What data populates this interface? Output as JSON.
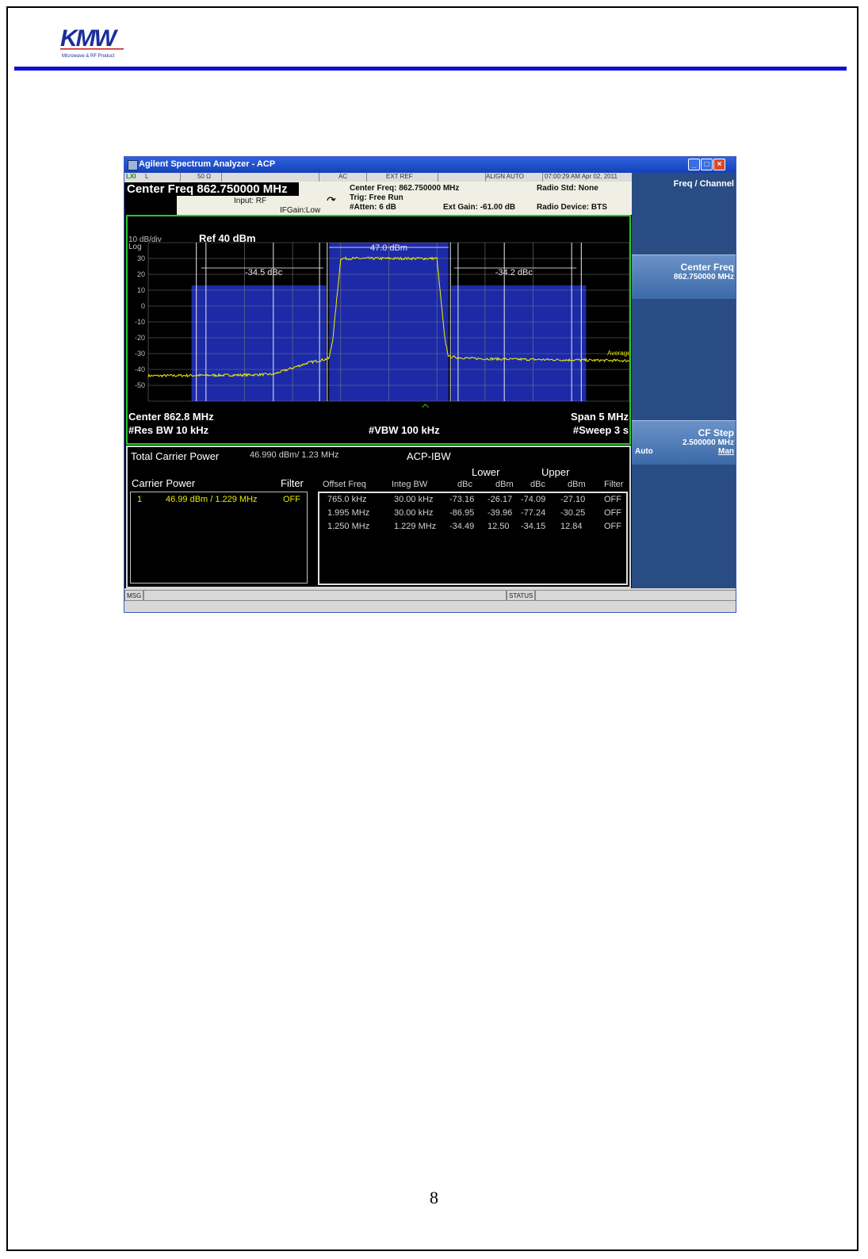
{
  "document": {
    "page_number": "8"
  },
  "logo": {
    "name": "KMW",
    "tagline": "Microwave & RF Product"
  },
  "window": {
    "title": "Agilent Spectrum Analyzer - ACP",
    "status_row": {
      "lxi": "LXI",
      "l": "L",
      "impedance": "50 Ω",
      "coupling": "AC",
      "ext_ref": "EXT REF",
      "align": "ALIGN AUTO",
      "timestamp": "07:00:29 AM Apr 02, 2011"
    },
    "center_freq_display": "Center Freq  862.750000 MHz",
    "input": "Input: RF",
    "ifgain": "IFGain:Low",
    "info_center": "Center Freq: 862.750000 MHz",
    "trig": "Trig: Free Run",
    "atten": "#Atten: 6 dB",
    "ext_gain": "Ext Gain: -61.00 dB",
    "radio_std": "Radio Std: None",
    "radio_device": "Radio Device: BTS"
  },
  "plot": {
    "scale": "10 dB/div",
    "scale_type": "Log",
    "ref": "Ref  40 dBm",
    "center": "Center  862.8 MHz",
    "res_bw": "#Res BW  10 kHz",
    "vbw": "#VBW  100 kHz",
    "span": "Span 5 MHz",
    "sweep": "#Sweep  3 s",
    "carrier_label": "47.0 dBm",
    "lower_label": "-34.5 dBc",
    "upper_label": "-34.2 dBc",
    "trace_tag": "Average",
    "colors": {
      "trace": "#f0f000",
      "channel": "#1c2aa8",
      "frame": "#28c828"
    }
  },
  "chart_data": {
    "type": "line",
    "xlabel": "",
    "ylabel": "",
    "ylim": [
      -60,
      40
    ],
    "yticks": [
      "30",
      "20",
      "10",
      "0",
      "-10",
      "-20",
      "-30",
      "-40",
      "-50"
    ],
    "x": [
      -2.5,
      -1.5,
      -1.2,
      -0.85,
      -0.62,
      -0.58,
      -0.5,
      0.5,
      0.58,
      0.62,
      0.85,
      1.2,
      2.5
    ],
    "series": [
      {
        "values": [
          -44,
          -43.5,
          -43,
          -36,
          -33,
          -20,
          30,
          30,
          -20,
          -32,
          -33,
          -33.5,
          -34.5
        ]
      }
    ]
  },
  "measurements": {
    "total_carrier_label": "Total Carrier Power",
    "total_carrier_value": "46.990 dBm/ 1.23 MHz",
    "title": "ACP-IBW",
    "carrier_power_label": "Carrier Power",
    "filter_label": "Filter",
    "carrier_row": {
      "index": "1",
      "power": "46.99 dBm /  1.229 MHz",
      "filter": "OFF"
    },
    "group_lower": "Lower",
    "group_upper": "Upper",
    "headers": [
      "Offset Freq",
      "Integ BW",
      "dBc",
      "dBm",
      "dBc",
      "dBm",
      "Filter"
    ],
    "rows": [
      [
        "765.0 kHz",
        "30.00 kHz",
        "-73.16",
        "-26.17",
        "-74.09",
        "-27.10",
        "OFF"
      ],
      [
        "1.995 MHz",
        "30.00 kHz",
        "-86.95",
        "-39.96",
        "-77.24",
        "-30.25",
        "OFF"
      ],
      [
        "1.250 MHz",
        "1.229 MHz",
        "-34.49",
        "12.50",
        "-34.15",
        "12.84",
        "OFF"
      ]
    ]
  },
  "statusbar": {
    "msg": "MSG",
    "status": "STATUS"
  },
  "softkeys": {
    "menu_title": "Freq / Channel",
    "center_freq": {
      "label": "Center Freq",
      "value": "862.750000 MHz"
    },
    "cf_step": {
      "label": "CF Step",
      "value": "2.500000 MHz",
      "auto": "Auto",
      "man": "Man"
    }
  }
}
